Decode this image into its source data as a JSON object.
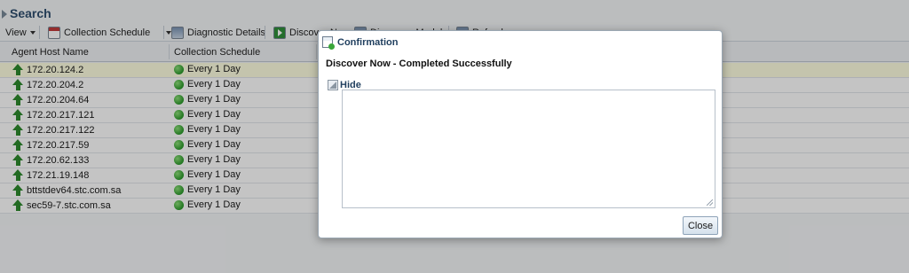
{
  "page": {
    "title": "Search"
  },
  "toolbar": {
    "view_label": "View",
    "collection_schedule_label": "Collection Schedule",
    "diagnostic_details_label": "Diagnostic Details",
    "discover_now_label": "Discover Now",
    "discovery_modules_label": "Discovery Modules",
    "refresh_label": "Refresh"
  },
  "table": {
    "columns": [
      "Agent Host Name",
      "Collection Schedule"
    ],
    "rows": [
      {
        "host": "172.20.124.2",
        "schedule": "Every 1 Day",
        "selected": true
      },
      {
        "host": "172.20.204.2",
        "schedule": "Every 1 Day"
      },
      {
        "host": "172.20.204.64",
        "schedule": "Every 1 Day"
      },
      {
        "host": "172.20.217.121",
        "schedule": "Every 1 Day"
      },
      {
        "host": "172.20.217.122",
        "schedule": "Every 1 Day"
      },
      {
        "host": "172.20.217.59",
        "schedule": "Every 1 Day"
      },
      {
        "host": "172.20.62.133",
        "schedule": "Every 1 Day"
      },
      {
        "host": "172.21.19.148",
        "schedule": "Every 1 Day"
      },
      {
        "host": "bttstdev64.stc.com.sa",
        "schedule": "Every 1 Day"
      },
      {
        "host": "sec59-7.stc.com.sa",
        "schedule": "Every 1 Day"
      }
    ]
  },
  "dialog": {
    "title": "Confirmation",
    "message": "Discover Now - Completed Successfully",
    "hide_label": "Hide",
    "details_text": "",
    "close_label": "Close"
  },
  "icons": {
    "host_status": "up-arrow-icon",
    "schedule_status": "green-dot-icon"
  },
  "colors": {
    "status_up": "#2d8a2d",
    "title_text": "#2f4f6f",
    "selected_row": "#ffffe1"
  }
}
